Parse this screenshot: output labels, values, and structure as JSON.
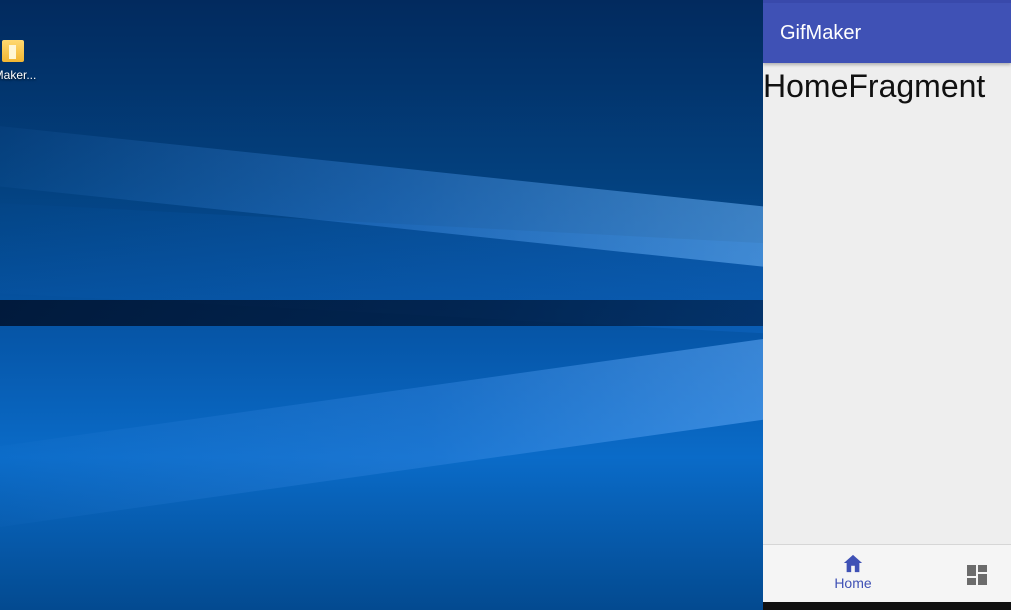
{
  "desktop": {
    "icons": [
      {
        "label": "Maker...",
        "icon": "folder-icon"
      }
    ]
  },
  "app": {
    "title": "GifMaker",
    "accent": "#3f51b5",
    "background": "#eeeeee"
  },
  "content": {
    "fragment_text": "HomeFragment"
  },
  "bottom_nav": {
    "items": [
      {
        "label": "Home",
        "icon": "home-icon",
        "selected": true
      },
      {
        "label": "",
        "icon": "dashboard-icon",
        "selected": false
      }
    ]
  }
}
